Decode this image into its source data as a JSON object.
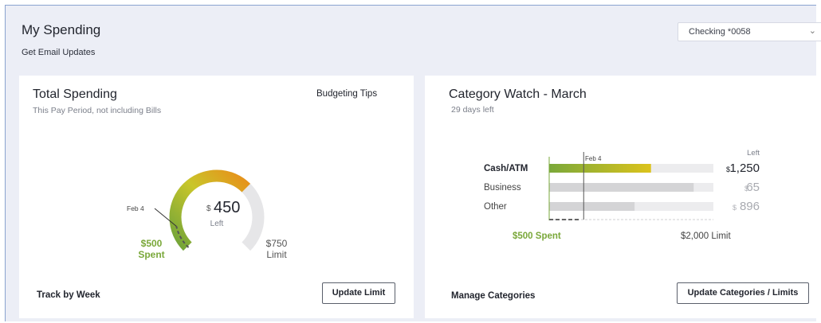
{
  "header": {
    "title": "My Spending",
    "email_link": "Get Email Updates",
    "account_select": "Checking *0058"
  },
  "total_spending": {
    "title": "Total Spending",
    "subtitle": "This Pay Period, not including Bills",
    "tips_link": "Budgeting Tips",
    "gauge": {
      "currency_symbol": "$",
      "amount_left": "450",
      "left_label": "Left",
      "date_marker": "Feb 4",
      "spent_amount": "$500",
      "spent_label": "Spent",
      "limit_amount": "$750",
      "limit_label": "Limit",
      "spent_value": 500,
      "limit_value": 750,
      "marker_fraction": 0.12
    },
    "track_link": "Track by Week",
    "update_button": "Update Limit"
  },
  "category_watch": {
    "title": "Category Watch - March",
    "subtitle": "29 days left",
    "left_header": "Left",
    "date_marker": "Feb 4",
    "marker_fraction": 0.21,
    "categories": [
      {
        "name": "Cash/ATM",
        "symbol": "$",
        "left": "1,250",
        "spent_fraction": 0.62,
        "budget_fraction": 1.0
      },
      {
        "name": "Business",
        "symbol": "$",
        "left": "65",
        "spent_fraction": 0.88,
        "budget_fraction": 1.0
      },
      {
        "name": "Other",
        "symbol": "$",
        "left": "896",
        "spent_fraction": 0.52,
        "budget_fraction": 1.0
      }
    ],
    "spent_total": "$500 Spent",
    "limit_total": "$2,000 Limit",
    "manage_link": "Manage Categories",
    "update_button": "Update Categories / Limits"
  },
  "colors": {
    "green": "#7aa83a",
    "yellow": "#d9c21e",
    "orange": "#e88f1a",
    "track": "#e4e4e6",
    "bar_gray": "#d4d4d6"
  }
}
